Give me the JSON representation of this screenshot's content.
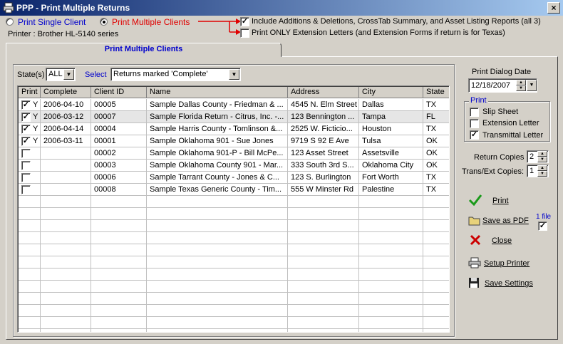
{
  "window": {
    "title": "PPP - Print Multiple Returns",
    "close_glyph": "×"
  },
  "mode": {
    "single_label": "Print Single Client",
    "multiple_label": "Print Multiple Clients",
    "selected": "multiple"
  },
  "options": {
    "include_label": "Include Additions & Deletions, CrossTab Summary, and Asset Listing Reports (all 3)",
    "include_checked": true,
    "extension_only_label": "Print ONLY Extension Letters (and Extension Forms if return is for Texas)",
    "extension_only_checked": false
  },
  "printer_label": "Printer : Brother HL-5140 series",
  "tab_label": "Print Multiple Clients",
  "filter": {
    "state_label": "State(s)",
    "state_value": "ALL",
    "select_label": "Select",
    "select_value": "Returns marked 'Complete'"
  },
  "grid": {
    "columns": [
      "Print",
      "Complete",
      "Client ID",
      "Name",
      "Address",
      "City",
      "State"
    ],
    "rows": [
      {
        "print": true,
        "flag": "Y",
        "complete": "2006-04-10",
        "client_id": "00005",
        "name": "Sample Dallas County - Friedman & ...",
        "address": "4545 N. Elm Street",
        "city": "Dallas",
        "state": "TX"
      },
      {
        "print": true,
        "flag": "Y",
        "complete": "2006-03-12",
        "client_id": "00007",
        "name": "Sample Florida Return - Citrus, Inc. -...",
        "address": "123 Bennington ...",
        "city": "Tampa",
        "state": "FL"
      },
      {
        "print": true,
        "flag": "Y",
        "complete": "2006-04-14",
        "client_id": "00004",
        "name": "Sample Harris County - Tomlinson &...",
        "address": "2525 W. Ficticio...",
        "city": "Houston",
        "state": "TX"
      },
      {
        "print": true,
        "flag": "Y",
        "complete": "2006-03-11",
        "client_id": "00001",
        "name": "Sample Oklahoma 901 - Sue Jones",
        "address": "9719 S 92 E Ave",
        "city": "Tulsa",
        "state": "OK"
      },
      {
        "print": false,
        "flag": "",
        "complete": "",
        "client_id": "00002",
        "name": "Sample Oklahoma 901-P - Bill McPe...",
        "address": "123 Asset Street",
        "city": "Assetsville",
        "state": "OK"
      },
      {
        "print": false,
        "flag": "",
        "complete": "",
        "client_id": "00003",
        "name": "Sample Oklahoma County 901 - Mar...",
        "address": "333 South 3rd S...",
        "city": "Oklahoma City",
        "state": "OK"
      },
      {
        "print": false,
        "flag": "",
        "complete": "",
        "client_id": "00006",
        "name": "Sample Tarrant County - Jones & C...",
        "address": "123 S. Burlington",
        "city": "Fort Worth",
        "state": "TX"
      },
      {
        "print": false,
        "flag": "",
        "complete": "",
        "client_id": "00008",
        "name": "Sample Texas Generic County - Tim...",
        "address": "555 W Minster Rd",
        "city": "Palestine",
        "state": "TX"
      }
    ],
    "selected_row": 1
  },
  "side": {
    "dialog_date_label": "Print Dialog Date",
    "dialog_date_value": "12/18/2007",
    "print_group_label": "Print",
    "slip_sheet_label": "Slip Sheet",
    "slip_sheet_checked": false,
    "extension_letter_label": "Extension Letter",
    "extension_letter_checked": false,
    "transmittal_letter_label": "Transmittal Letter",
    "transmittal_letter_checked": true,
    "return_copies_label": "Return Copies",
    "return_copies_value": "2",
    "trans_ext_copies_label": "Trans/Ext Copies:",
    "trans_ext_copies_value": "1",
    "print_button": "Print",
    "save_pdf_button": "Save as PDF",
    "one_file_label": "1 file",
    "one_file_checked": true,
    "close_button": "Close",
    "setup_printer_button": "Setup Printer",
    "save_settings_button": "Save Settings"
  },
  "colors": {
    "accent_blue": "#0000cc",
    "highlight_red": "#e00000",
    "check_green": "#1a9a1a",
    "close_red": "#cc0000"
  }
}
